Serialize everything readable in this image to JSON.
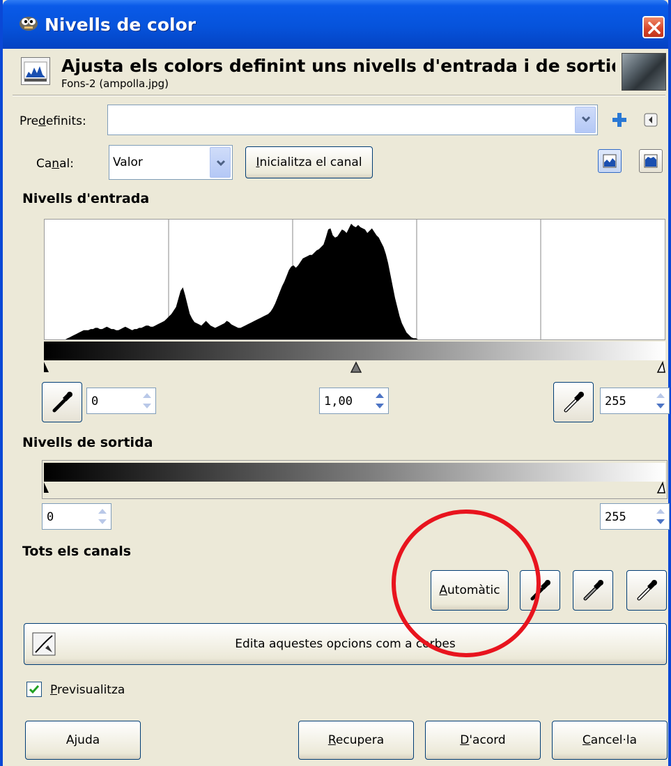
{
  "window": {
    "title": "Nivells de color"
  },
  "header": {
    "title": "Ajusta els colors definint uns nivells d'entrada i de sortida pe",
    "subtitle": "Fons-2 (ampolla.jpg)"
  },
  "presets": {
    "label_pre": "Pre",
    "label_mnemonic": "d",
    "label_post": "efinits:",
    "value": ""
  },
  "channel": {
    "label_pre": "Ca",
    "label_mnemonic": "n",
    "label_post": "al:",
    "value": "Valor",
    "reset_mnemonic": "I",
    "reset_rest": "nicialitza el canal"
  },
  "input_levels": {
    "title": "Nivells d'entrada",
    "low": "0",
    "gamma": "1,00",
    "high": "255"
  },
  "output_levels": {
    "title": "Nivells de sortida",
    "low": "0",
    "high": "255"
  },
  "all_channels": {
    "title": "Tots els canals",
    "auto_mnemonic": "A",
    "auto_rest": "utomàtic"
  },
  "curves_button": {
    "label": "Edita aquestes opcions com a corbes"
  },
  "preview": {
    "mnemonic": "P",
    "rest": "revisualitza",
    "checked": true
  },
  "buttons": {
    "help": "Ajuda",
    "reset_mnemonic": "R",
    "reset_rest": "ecupera",
    "ok_mnemonic": "D",
    "ok_rest": "'acord",
    "cancel_mnemonic": "C",
    "cancel_rest": "ancel·la"
  },
  "colors": {
    "titlebar": "#0653db",
    "dialog_bg": "#ece9d8",
    "close": "#d6452a",
    "highlight_circle": "#e8141e"
  },
  "histogram_values": [
    0,
    0,
    0,
    0,
    0,
    0,
    0,
    0,
    0,
    0,
    1,
    2,
    3,
    4,
    5,
    6,
    7,
    8,
    8,
    8,
    9,
    9,
    10,
    10,
    9,
    9,
    10,
    11,
    10,
    9,
    9,
    8,
    8,
    9,
    10,
    11,
    10,
    9,
    8,
    9,
    9,
    10,
    10,
    11,
    12,
    12,
    11,
    11,
    12,
    13,
    14,
    15,
    16,
    18,
    20,
    22,
    25,
    28,
    35,
    42,
    45,
    38,
    30,
    22,
    18,
    15,
    14,
    13,
    12,
    14,
    16,
    14,
    12,
    11,
    10,
    11,
    12,
    13,
    14,
    16,
    15,
    13,
    12,
    11,
    10,
    10,
    11,
    12,
    13,
    14,
    15,
    16,
    17,
    18,
    19,
    20,
    21,
    22,
    24,
    27,
    31,
    36,
    41,
    46,
    50,
    55,
    60,
    63,
    64,
    62,
    64,
    67,
    70,
    71,
    72,
    73,
    73,
    75,
    77,
    78,
    80,
    82,
    88,
    95,
    96,
    90,
    88,
    89,
    92,
    95,
    94,
    92,
    96,
    100,
    98,
    97,
    99,
    97,
    96,
    95,
    92,
    94,
    96,
    93,
    90,
    88,
    84,
    80,
    74,
    66,
    56,
    46,
    36,
    28,
    20,
    14,
    10,
    6,
    4,
    2,
    1,
    1,
    0,
    0,
    0,
    0,
    0,
    0,
    0,
    0,
    0,
    0,
    0,
    0,
    0,
    0,
    0,
    0,
    0,
    0,
    0,
    0,
    0,
    0,
    0,
    0,
    0,
    0,
    0,
    0,
    0,
    0,
    0,
    0,
    0,
    0,
    0,
    0,
    0,
    0,
    0,
    0,
    0,
    0,
    0,
    0,
    0,
    0,
    0,
    0,
    0,
    0,
    0,
    0,
    0,
    0,
    0,
    0,
    0,
    0,
    0,
    0,
    0,
    0,
    0,
    0,
    0,
    0,
    0,
    0,
    0,
    0,
    0,
    0,
    0,
    0,
    0,
    0,
    0,
    0,
    0,
    0,
    0,
    0,
    0,
    0,
    0,
    0,
    0,
    0,
    0,
    0,
    0,
    0,
    0,
    0,
    0,
    0,
    0,
    0,
    0,
    0,
    0,
    0,
    0,
    0,
    0,
    0,
    0,
    0
  ]
}
